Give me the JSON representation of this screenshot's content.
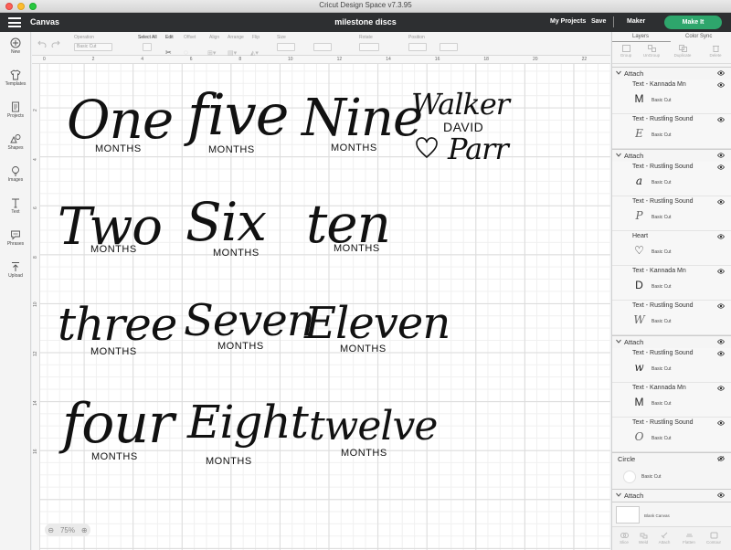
{
  "window": {
    "title": "Cricut Design Space  v7.3.95"
  },
  "header": {
    "section": "Canvas",
    "project_name": "milestone discs",
    "my_projects": "My Projects",
    "save": "Save",
    "machine": "Maker",
    "make_it": "Make It",
    "make_it_color": "#2ea66c"
  },
  "sidebar": {
    "items": [
      {
        "label": "New",
        "icon": "plus-circle-icon"
      },
      {
        "label": "Templates",
        "icon": "shirt-icon"
      },
      {
        "label": "Projects",
        "icon": "projects-icon"
      },
      {
        "label": "Shapes",
        "icon": "shapes-icon"
      },
      {
        "label": "Images",
        "icon": "lightbulb-icon"
      },
      {
        "label": "Text",
        "icon": "text-icon"
      },
      {
        "label": "Phrases",
        "icon": "speech-bubble-icon"
      },
      {
        "label": "Upload",
        "icon": "upload-icon"
      }
    ]
  },
  "toolbar": {
    "operation_label": "Operation",
    "operation_value": "Basic Cut",
    "select_all": "Select All",
    "edit": "Edit",
    "offset": "Offset",
    "align": "Align",
    "arrange": "Arrange",
    "flip": "Flip",
    "size": "Size",
    "rotate": "Rotate",
    "position": "Position"
  },
  "rulers": {
    "top": [
      "0",
      "2",
      "4",
      "6",
      "8",
      "10",
      "12",
      "14",
      "16",
      "18",
      "20",
      "22"
    ],
    "left": [
      "2",
      "4",
      "6",
      "8",
      "10",
      "12",
      "14",
      "16"
    ]
  },
  "canvas": {
    "zoom": "75%",
    "discs": [
      {
        "script": "One",
        "sub": "MONTHS"
      },
      {
        "script": "five",
        "sub": "MONTHS"
      },
      {
        "script": "Nine",
        "sub": "MONTHS"
      },
      {
        "script_top": "Walker",
        "sub": "DAVID",
        "script_bottom": "Parr"
      },
      {
        "script": "Two",
        "sub": "MONTHS"
      },
      {
        "script": "Six",
        "sub": "MONTHS"
      },
      {
        "script": "ten",
        "sub": "MONTHS"
      },
      {
        "script": "three",
        "sub": "MONTHS"
      },
      {
        "script": "Seven",
        "sub": "MONTHS"
      },
      {
        "script": "Eleven",
        "sub": "MONTHS"
      },
      {
        "script": "four",
        "sub": "MONTHS"
      },
      {
        "script": "Eight",
        "sub": "MONTHS"
      },
      {
        "script": "twelve",
        "sub": "MONTHS"
      }
    ]
  },
  "panel": {
    "tabs": [
      "Layers",
      "Color Sync"
    ],
    "actions": [
      "Group",
      "UnGroup",
      "Duplicate",
      "Delete"
    ],
    "bottom_actions": [
      "Slice",
      "Weld",
      "Attach",
      "Flatten",
      "Contour"
    ],
    "layers": [
      {
        "kind": "group",
        "name": "Attach"
      },
      {
        "kind": "text",
        "name": "Text - Kannada Mn",
        "op": "Basic Cut",
        "thumb": "M"
      },
      {
        "kind": "text",
        "name": "Text - Rustling Sound",
        "op": "Basic Cut",
        "thumb": "E"
      },
      {
        "kind": "group",
        "name": "Attach"
      },
      {
        "kind": "text",
        "name": "Text - Rustling Sound",
        "op": "Basic Cut",
        "thumb": "a"
      },
      {
        "kind": "text",
        "name": "Text - Rustling Sound",
        "op": "Basic Cut",
        "thumb": "P"
      },
      {
        "kind": "text",
        "name": "Heart",
        "op": "Basic Cut",
        "thumb": "♡"
      },
      {
        "kind": "text",
        "name": "Text - Kannada Mn",
        "op": "Basic Cut",
        "thumb": "D"
      },
      {
        "kind": "text",
        "name": "Text - Rustling Sound",
        "op": "Basic Cut",
        "thumb": "W"
      },
      {
        "kind": "group",
        "name": "Attach"
      },
      {
        "kind": "text",
        "name": "Text - Rustling Sound",
        "op": "Basic Cut",
        "thumb": "w"
      },
      {
        "kind": "text",
        "name": "Text - Kannada Mn",
        "op": "Basic Cut",
        "thumb": "M"
      },
      {
        "kind": "text",
        "name": "Text - Rustling Sound",
        "op": "Basic Cut",
        "thumb": "O"
      },
      {
        "kind": "group",
        "name": "Circle"
      },
      {
        "kind": "text",
        "name": "",
        "op": "Basic Cut",
        "thumb": "○"
      },
      {
        "kind": "group",
        "name": "Attach"
      }
    ],
    "blank_canvas": "Blank Canvas"
  }
}
